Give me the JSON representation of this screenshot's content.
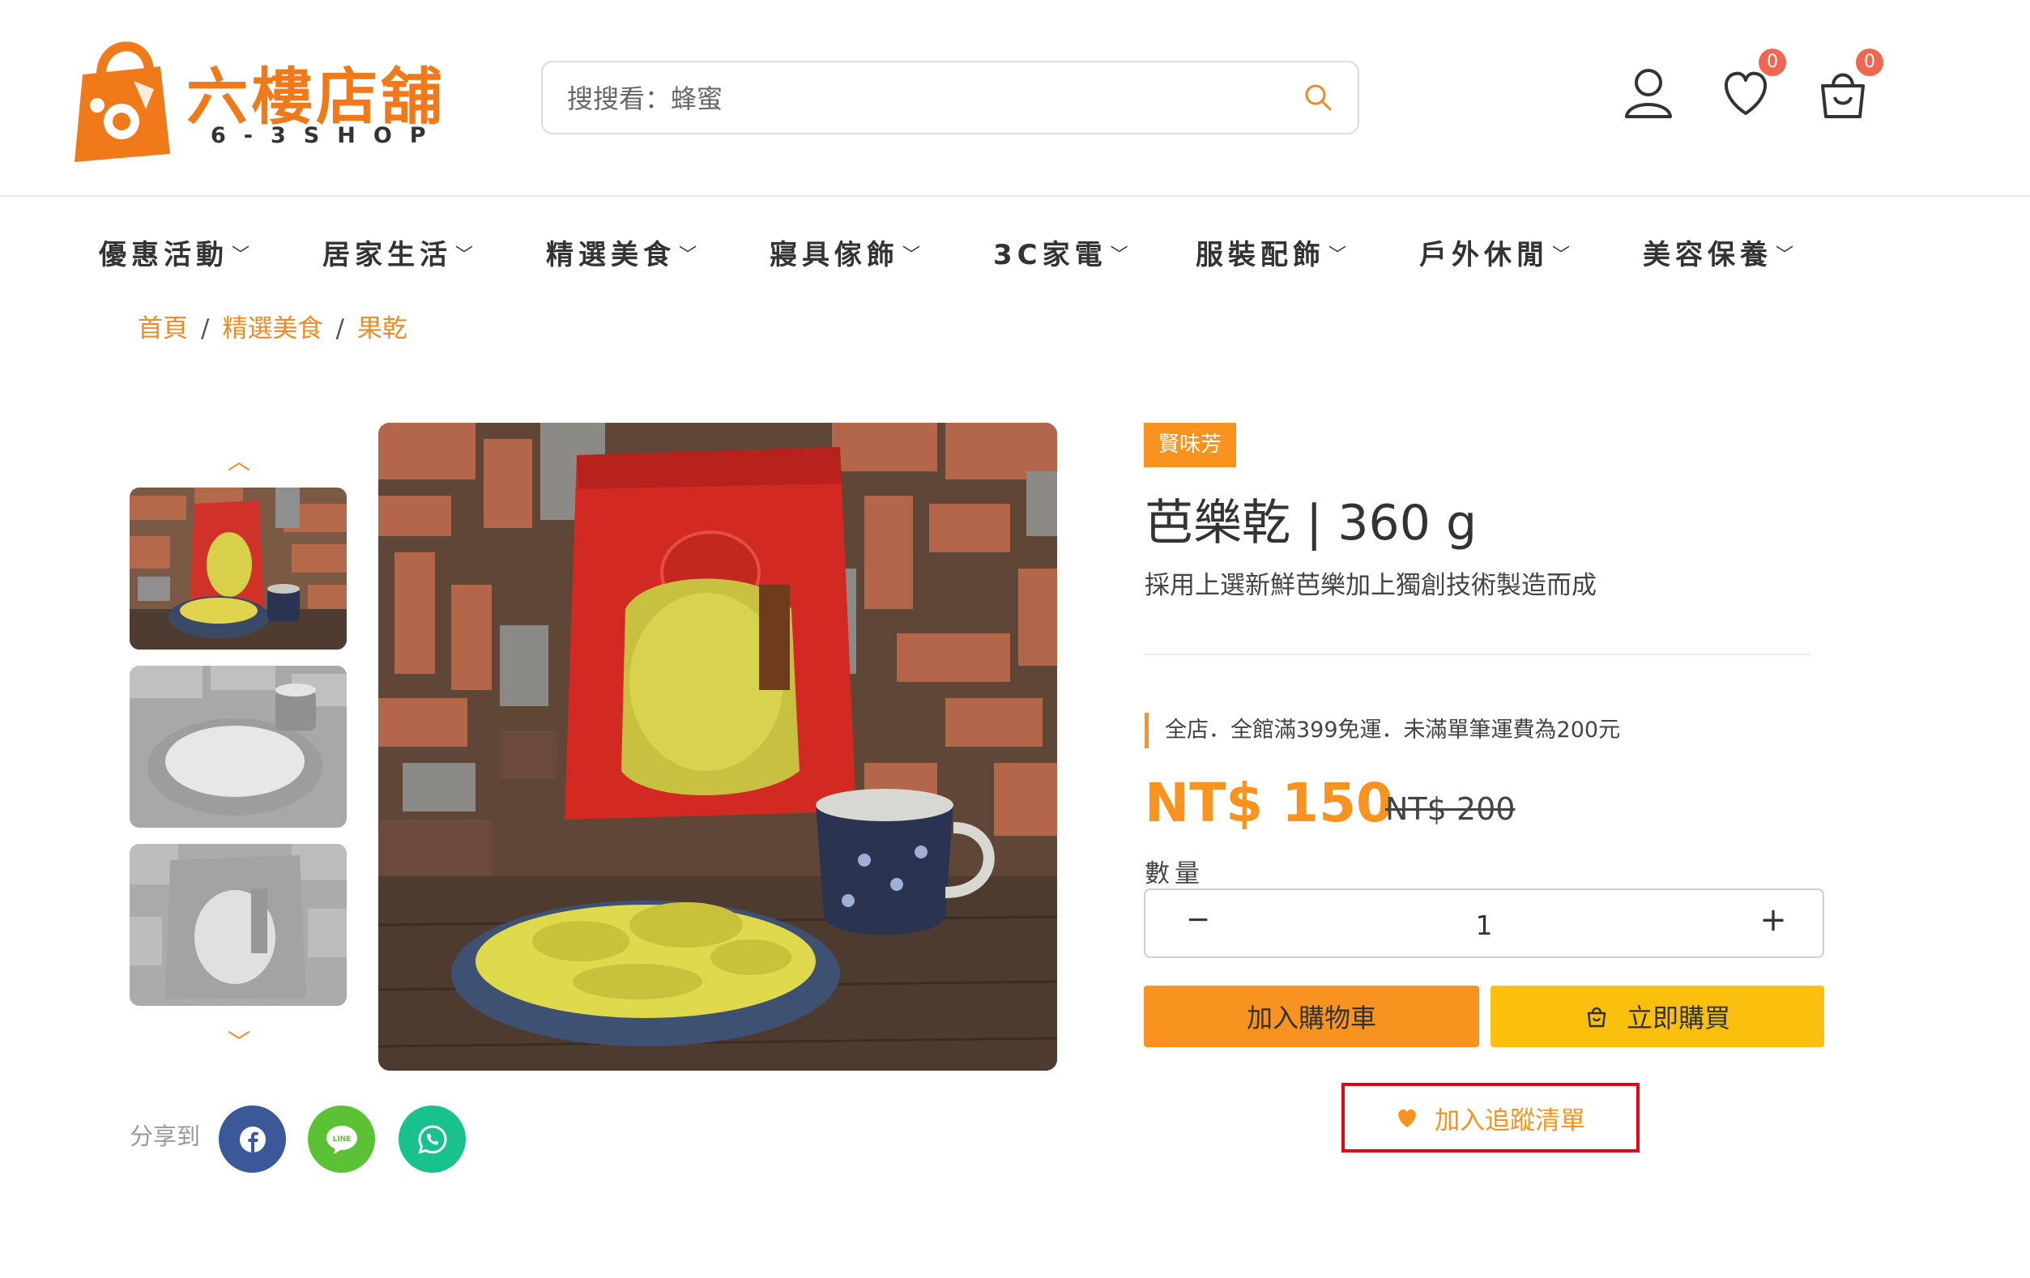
{
  "brand": {
    "name": "六樓店舖",
    "sub": "6-3SHOP",
    "color": "#f07a1a"
  },
  "search": {
    "placeholder": "搜搜看：蜂蜜"
  },
  "header_icons": {
    "wishlist_count": "0",
    "cart_count": "0"
  },
  "nav": [
    {
      "label": "優惠活動"
    },
    {
      "label": "居家生活"
    },
    {
      "label": "精選美食"
    },
    {
      "label": "寢具傢飾"
    },
    {
      "label": "3C家電"
    },
    {
      "label": "服裝配飾"
    },
    {
      "label": "戶外休閒"
    },
    {
      "label": "美容保養"
    }
  ],
  "breadcrumb": [
    "首頁",
    "精選美食",
    "果乾"
  ],
  "gallery": {
    "up_arrow": "︿",
    "down_arrow": "﹀"
  },
  "share": {
    "label": "分享到",
    "networks": [
      "facebook",
      "line",
      "whatsapp"
    ],
    "line_text": "LINE"
  },
  "product": {
    "brand_tag": "賢味芳",
    "title": "芭樂乾 | 360 g",
    "subtitle": "採用上選新鮮芭樂加上獨創技術製造而成",
    "promo": "全店．全館滿399免運．未滿單筆運費為200元",
    "price": "NT$ 150",
    "old_price": "NT$ 200",
    "qty_label": "數量",
    "qty_value": "1",
    "qty_minus": "−",
    "qty_plus": "+",
    "add_to_cart": "加入購物車",
    "buy_now": "立即購買",
    "add_to_wishlist": "加入追蹤清單"
  },
  "colors": {
    "accent": "#f7931e",
    "buy": "#fbbf0e",
    "highlight_border": "#e30613",
    "badge": "#f0674f",
    "facebook": "#3b5998",
    "line": "#5bc236",
    "whatsapp": "#19c28c"
  }
}
